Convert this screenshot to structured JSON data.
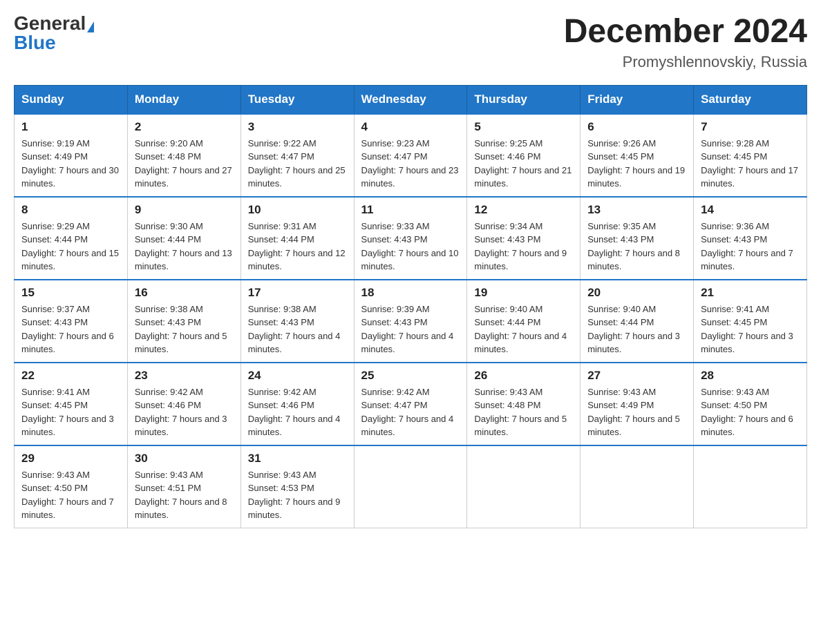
{
  "header": {
    "logo_general": "General",
    "logo_blue": "Blue",
    "month_title": "December 2024",
    "location": "Promyshlennovskiy, Russia"
  },
  "days_of_week": [
    "Sunday",
    "Monday",
    "Tuesday",
    "Wednesday",
    "Thursday",
    "Friday",
    "Saturday"
  ],
  "weeks": [
    [
      {
        "day": "1",
        "sunrise": "9:19 AM",
        "sunset": "4:49 PM",
        "daylight": "7 hours and 30 minutes."
      },
      {
        "day": "2",
        "sunrise": "9:20 AM",
        "sunset": "4:48 PM",
        "daylight": "7 hours and 27 minutes."
      },
      {
        "day": "3",
        "sunrise": "9:22 AM",
        "sunset": "4:47 PM",
        "daylight": "7 hours and 25 minutes."
      },
      {
        "day": "4",
        "sunrise": "9:23 AM",
        "sunset": "4:47 PM",
        "daylight": "7 hours and 23 minutes."
      },
      {
        "day": "5",
        "sunrise": "9:25 AM",
        "sunset": "4:46 PM",
        "daylight": "7 hours and 21 minutes."
      },
      {
        "day": "6",
        "sunrise": "9:26 AM",
        "sunset": "4:45 PM",
        "daylight": "7 hours and 19 minutes."
      },
      {
        "day": "7",
        "sunrise": "9:28 AM",
        "sunset": "4:45 PM",
        "daylight": "7 hours and 17 minutes."
      }
    ],
    [
      {
        "day": "8",
        "sunrise": "9:29 AM",
        "sunset": "4:44 PM",
        "daylight": "7 hours and 15 minutes."
      },
      {
        "day": "9",
        "sunrise": "9:30 AM",
        "sunset": "4:44 PM",
        "daylight": "7 hours and 13 minutes."
      },
      {
        "day": "10",
        "sunrise": "9:31 AM",
        "sunset": "4:44 PM",
        "daylight": "7 hours and 12 minutes."
      },
      {
        "day": "11",
        "sunrise": "9:33 AM",
        "sunset": "4:43 PM",
        "daylight": "7 hours and 10 minutes."
      },
      {
        "day": "12",
        "sunrise": "9:34 AM",
        "sunset": "4:43 PM",
        "daylight": "7 hours and 9 minutes."
      },
      {
        "day": "13",
        "sunrise": "9:35 AM",
        "sunset": "4:43 PM",
        "daylight": "7 hours and 8 minutes."
      },
      {
        "day": "14",
        "sunrise": "9:36 AM",
        "sunset": "4:43 PM",
        "daylight": "7 hours and 7 minutes."
      }
    ],
    [
      {
        "day": "15",
        "sunrise": "9:37 AM",
        "sunset": "4:43 PM",
        "daylight": "7 hours and 6 minutes."
      },
      {
        "day": "16",
        "sunrise": "9:38 AM",
        "sunset": "4:43 PM",
        "daylight": "7 hours and 5 minutes."
      },
      {
        "day": "17",
        "sunrise": "9:38 AM",
        "sunset": "4:43 PM",
        "daylight": "7 hours and 4 minutes."
      },
      {
        "day": "18",
        "sunrise": "9:39 AM",
        "sunset": "4:43 PM",
        "daylight": "7 hours and 4 minutes."
      },
      {
        "day": "19",
        "sunrise": "9:40 AM",
        "sunset": "4:44 PM",
        "daylight": "7 hours and 4 minutes."
      },
      {
        "day": "20",
        "sunrise": "9:40 AM",
        "sunset": "4:44 PM",
        "daylight": "7 hours and 3 minutes."
      },
      {
        "day": "21",
        "sunrise": "9:41 AM",
        "sunset": "4:45 PM",
        "daylight": "7 hours and 3 minutes."
      }
    ],
    [
      {
        "day": "22",
        "sunrise": "9:41 AM",
        "sunset": "4:45 PM",
        "daylight": "7 hours and 3 minutes."
      },
      {
        "day": "23",
        "sunrise": "9:42 AM",
        "sunset": "4:46 PM",
        "daylight": "7 hours and 3 minutes."
      },
      {
        "day": "24",
        "sunrise": "9:42 AM",
        "sunset": "4:46 PM",
        "daylight": "7 hours and 4 minutes."
      },
      {
        "day": "25",
        "sunrise": "9:42 AM",
        "sunset": "4:47 PM",
        "daylight": "7 hours and 4 minutes."
      },
      {
        "day": "26",
        "sunrise": "9:43 AM",
        "sunset": "4:48 PM",
        "daylight": "7 hours and 5 minutes."
      },
      {
        "day": "27",
        "sunrise": "9:43 AM",
        "sunset": "4:49 PM",
        "daylight": "7 hours and 5 minutes."
      },
      {
        "day": "28",
        "sunrise": "9:43 AM",
        "sunset": "4:50 PM",
        "daylight": "7 hours and 6 minutes."
      }
    ],
    [
      {
        "day": "29",
        "sunrise": "9:43 AM",
        "sunset": "4:50 PM",
        "daylight": "7 hours and 7 minutes."
      },
      {
        "day": "30",
        "sunrise": "9:43 AM",
        "sunset": "4:51 PM",
        "daylight": "7 hours and 8 minutes."
      },
      {
        "day": "31",
        "sunrise": "9:43 AM",
        "sunset": "4:53 PM",
        "daylight": "7 hours and 9 minutes."
      },
      null,
      null,
      null,
      null
    ]
  ]
}
